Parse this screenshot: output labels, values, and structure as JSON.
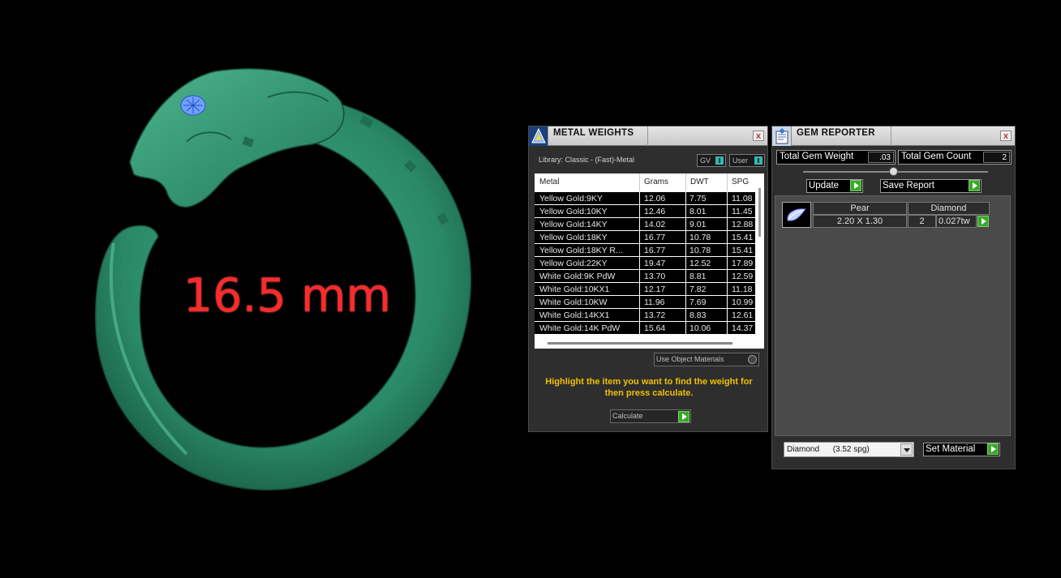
{
  "viewport": {
    "size_label": "16.5 mm",
    "ring_color": "#2a8a68"
  },
  "metal_weights": {
    "title": "METAL WEIGHTS",
    "close": "x",
    "library": "Library: Classic - (Fast)-Metal",
    "toggle_gv": "GV",
    "toggle_user": "User",
    "columns": [
      "Metal",
      "Grams",
      "DWT",
      "SPG"
    ],
    "rows": [
      [
        "Yellow Gold:9KY",
        "12.06",
        "7.75",
        "11.08"
      ],
      [
        "Yellow Gold:10KY",
        "12.46",
        "8.01",
        "11.45"
      ],
      [
        "Yellow Gold:14KY",
        "14.02",
        "9.01",
        "12.88"
      ],
      [
        "Yellow Gold:18KY",
        "16.77",
        "10.78",
        "15.41"
      ],
      [
        "Yellow Gold:18KY R...",
        "16.77",
        "10.78",
        "15.41"
      ],
      [
        "Yellow Gold:22KY",
        "19.47",
        "12.52",
        "17.89"
      ],
      [
        "White Gold:9K PdW",
        "13.70",
        "8.81",
        "12.59"
      ],
      [
        "White Gold:10KX1",
        "12.17",
        "7.82",
        "11.18"
      ],
      [
        "White Gold:10KW",
        "11.96",
        "7.69",
        "10.99"
      ],
      [
        "White Gold:14KX1",
        "13.72",
        "8.83",
        "12.61"
      ],
      [
        "White Gold:14K PdW",
        "15.64",
        "10.06",
        "14.37"
      ]
    ],
    "use_object_materials": "Use Object Materials",
    "hint": "Highlight the item you want to find the weight for then press calculate.",
    "calculate": "Calculate"
  },
  "gem_reporter": {
    "title": "GEM REPORTER",
    "close": "x",
    "total_gem_weight_label": "Total Gem Weight",
    "total_gem_weight_value": ".03",
    "total_gem_count_label": "Total Gem Count",
    "total_gem_count_value": "2",
    "update": "Update",
    "save_report": "Save Report",
    "gem": {
      "shape": "Pear",
      "material": "Diamond",
      "size": "2.20 X 1.30",
      "count": "2",
      "weight": "0.027tw"
    },
    "material_select": "Diamond      (3.52 spg)",
    "set_material": "Set Material"
  }
}
